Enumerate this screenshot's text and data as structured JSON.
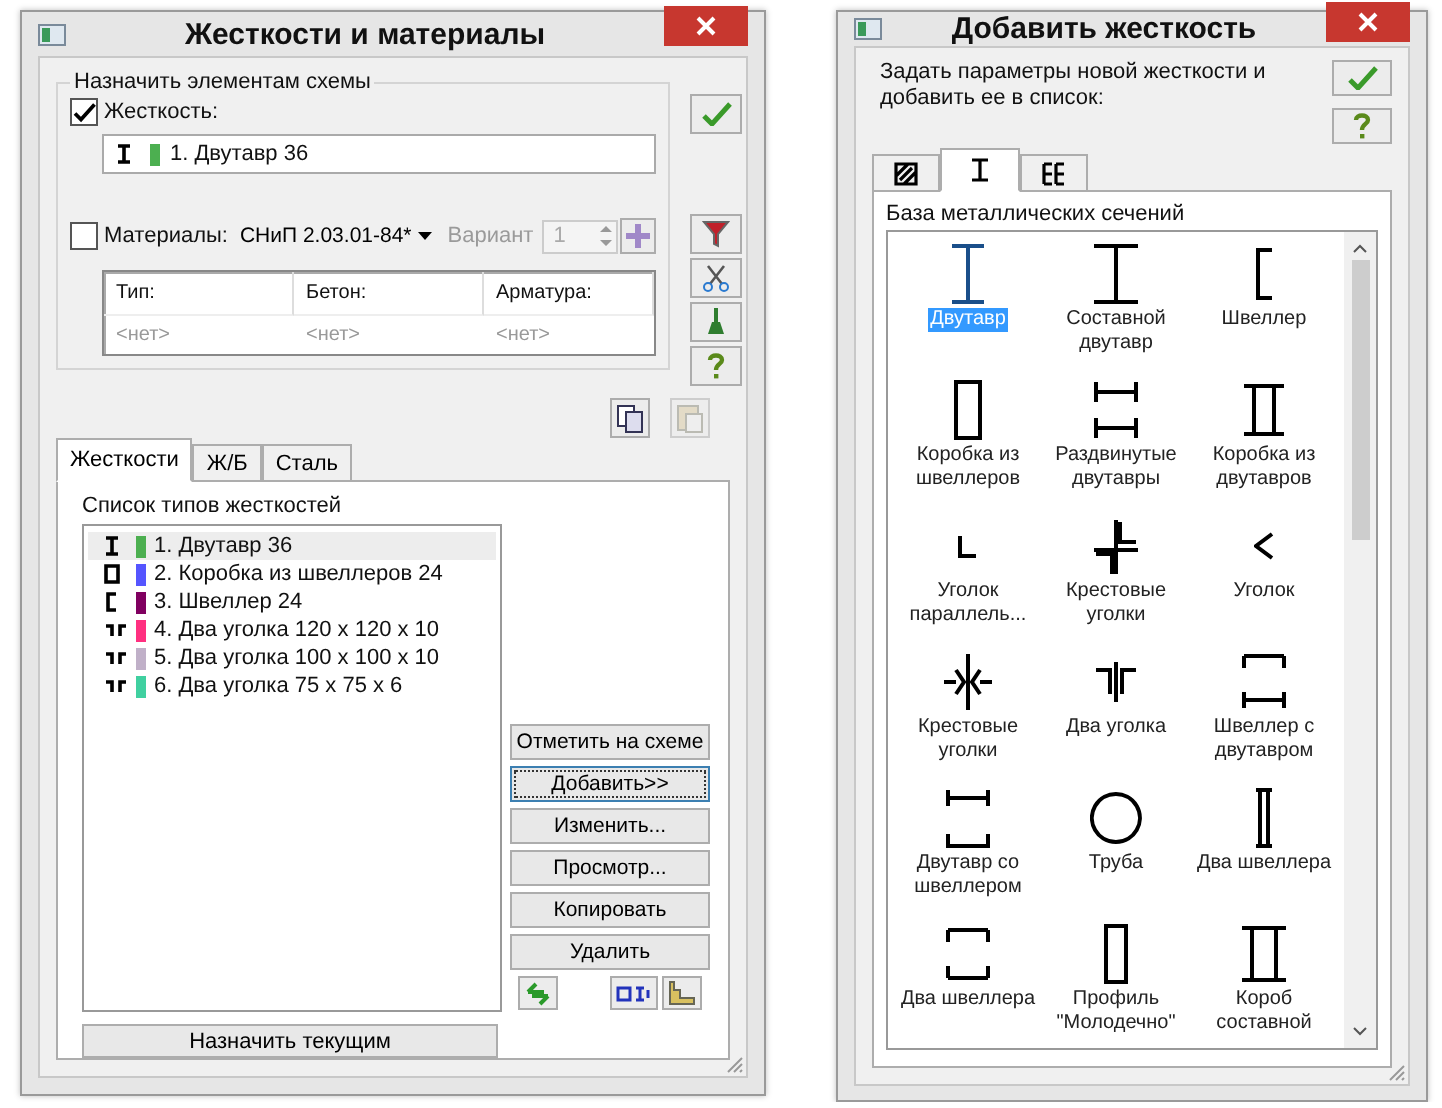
{
  "windows": [
    {
      "title": "Жесткости и материалы",
      "group": {
        "caption": "Назначить элементам схемы",
        "stiffness": {
          "label": "Жесткость:",
          "checked": true,
          "value": "1. Двутавр 36",
          "color": "#4caf50"
        },
        "materials": {
          "label": "Материалы:",
          "checked": false,
          "norm": "СНиП 2.03.01-84*",
          "variant_label": "Вариант",
          "variant": "1",
          "disabled": true
        },
        "table": {
          "columns": [
            "Тип:",
            "Бетон:",
            "Арматура:"
          ],
          "rows": [
            [
              "<нет>",
              "<нет>",
              "<нет>"
            ]
          ]
        }
      },
      "tabs": [
        {
          "label": "Жесткости",
          "selected": true
        },
        {
          "label": "Ж/Б",
          "selected": false
        },
        {
          "label": "Сталь",
          "selected": false
        }
      ],
      "list_caption": "Список типов жесткостей",
      "items": [
        {
          "text": "1. Двутавр 36",
          "color": "#4caf50",
          "selected": true
        },
        {
          "text": "2. Коробка из швеллеров 24",
          "color": "#5555ff",
          "selected": false
        },
        {
          "text": "3. Швеллер 24",
          "color": "#800060",
          "selected": false
        },
        {
          "text": "4. Два уголка 120 x 120 x 10",
          "color": "#ff3080",
          "selected": false
        },
        {
          "text": "5. Два уголка 100 x 100 x 10",
          "color": "#c0b0c8",
          "selected": false
        },
        {
          "text": "6. Два уголка 75 x 75 x 6",
          "color": "#40d0a0",
          "selected": false
        }
      ],
      "buttons": [
        {
          "label": "Отметить на схеме",
          "focused": false
        },
        {
          "label": "Добавить>>",
          "focused": true
        },
        {
          "label": "Изменить...",
          "focused": false
        },
        {
          "label": "Просмотр...",
          "focused": false
        },
        {
          "label": "Копировать",
          "focused": false
        },
        {
          "label": "Удалить",
          "focused": false
        }
      ],
      "assign_button": "Назначить текущим"
    },
    {
      "title": "Добавить жесткость",
      "description": "Задать параметры новой жесткости и добавить ее в список:",
      "tabs": [
        {
          "selected": false
        },
        {
          "selected": true
        },
        {
          "selected": false
        }
      ],
      "caption": "База металлических сечений",
      "sections": [
        {
          "label": "Двутавр",
          "selected": true
        },
        {
          "label": "Составной двутавр",
          "selected": false
        },
        {
          "label": "Швеллер",
          "selected": false
        },
        {
          "label": "Коробка из швеллеров",
          "selected": false
        },
        {
          "label": "Раздвинутые двутавры",
          "selected": false
        },
        {
          "label": "Коробка из двутавров",
          "selected": false
        },
        {
          "label": "Уголок параллель...",
          "selected": false
        },
        {
          "label": "Крестовые уголки",
          "selected": false
        },
        {
          "label": "Уголок",
          "selected": false
        },
        {
          "label": "Крестовые уголки",
          "selected": false
        },
        {
          "label": "Два уголка",
          "selected": false
        },
        {
          "label": "Швеллер с двутавром",
          "selected": false
        },
        {
          "label": "Двутавр со швеллером",
          "selected": false
        },
        {
          "label": "Труба",
          "selected": false
        },
        {
          "label": "Два швеллера",
          "selected": false
        },
        {
          "label": "Два швеллера",
          "selected": false
        },
        {
          "label": "Профиль \"Молодечно\"",
          "selected": false
        },
        {
          "label": "Короб составной",
          "selected": false
        }
      ]
    }
  ]
}
